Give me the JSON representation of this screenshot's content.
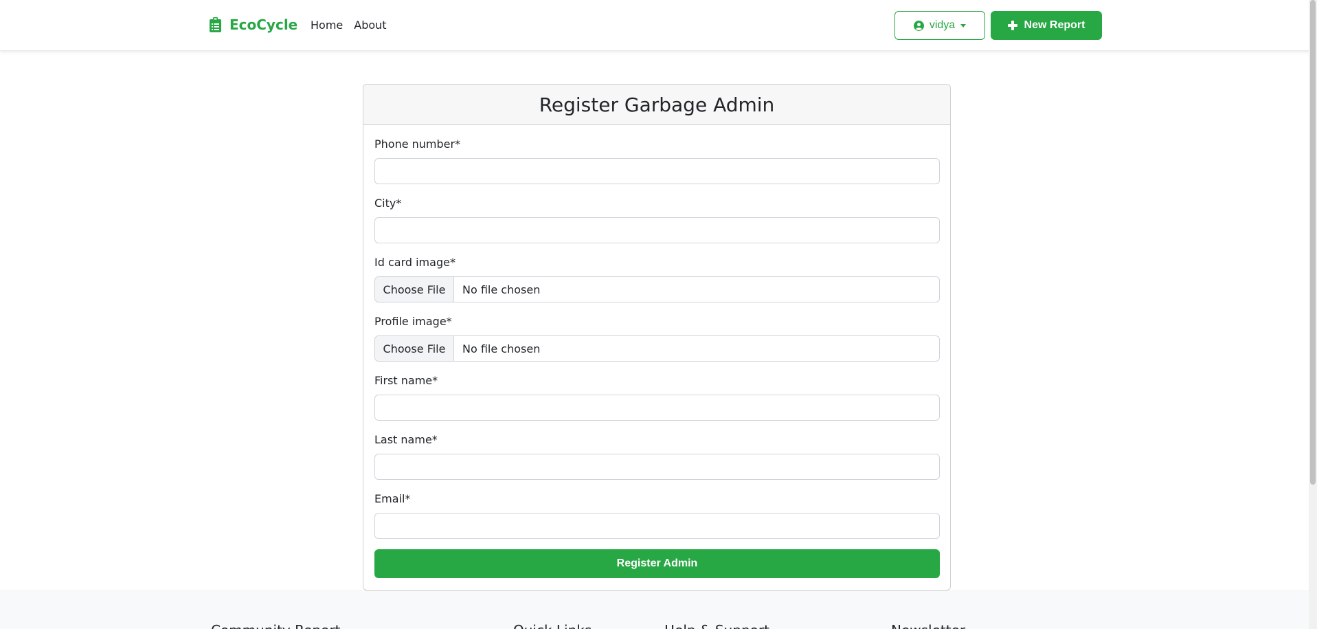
{
  "navbar": {
    "brand": "EcoCycle",
    "links": [
      "Home",
      "About"
    ],
    "user_label": "vidya",
    "new_report_label": "New Report",
    "accent_color": "#28a745"
  },
  "form": {
    "title": "Register Garbage Admin",
    "fields": [
      {
        "label": "Phone number*",
        "type": "text",
        "value": ""
      },
      {
        "label": "City*",
        "type": "text",
        "value": ""
      },
      {
        "label": "Id card image*",
        "type": "file",
        "button": "Choose File",
        "status": "No file chosen"
      },
      {
        "label": "Profile image*",
        "type": "file",
        "button": "Choose File",
        "status": "No file chosen"
      },
      {
        "label": "First name*",
        "type": "text",
        "value": ""
      },
      {
        "label": "Last name*",
        "type": "text",
        "value": ""
      },
      {
        "label": "Email*",
        "type": "text",
        "value": ""
      }
    ],
    "submit_label": "Register Admin"
  },
  "footer": {
    "headings": [
      "Community Report",
      "Quick Links",
      "Help & Support",
      "Newsletter"
    ]
  },
  "icons": {
    "brand_icon": "clipboard-icon",
    "user_icon": "user-circle-icon",
    "user_caret": "caret-down-icon",
    "new_report_icon": "plus-icon"
  }
}
